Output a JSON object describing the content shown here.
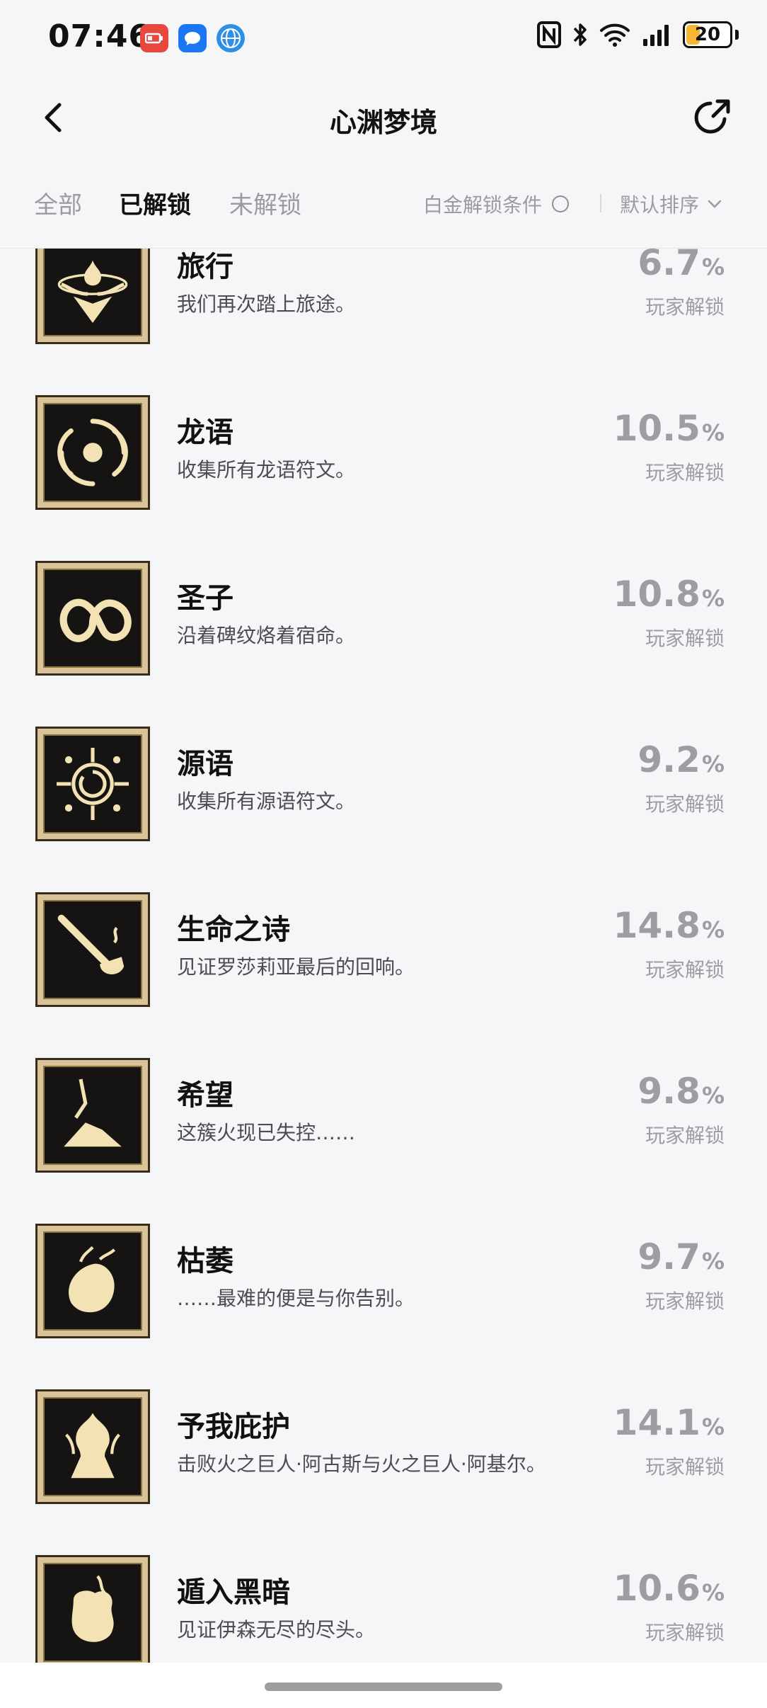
{
  "status_bar": {
    "time": "07:46",
    "battery": "20",
    "battery_level": 0.2,
    "notifications": [
      "battery-saver-icon",
      "message-icon",
      "browser-icon"
    ],
    "system_icons": [
      "nfc-icon",
      "bluetooth-icon",
      "wifi-icon",
      "signal-icon",
      "battery-icon"
    ]
  },
  "header": {
    "title": "心渊梦境"
  },
  "tabs": {
    "all": "全部",
    "unlocked": "已解锁",
    "locked": "未解锁",
    "active": "unlocked"
  },
  "filters": {
    "platinum_label": "白金解锁条件",
    "sort_label": "默认排序"
  },
  "achievements": [
    {
      "name": "旅行",
      "desc": "我们再次踏上旅途。",
      "percent": "6.7",
      "unit": "%",
      "caption": "玩家解锁",
      "icon": "winged-flame-icon"
    },
    {
      "name": "龙语",
      "desc": "收集所有龙语符文。",
      "percent": "10.5",
      "unit": "%",
      "caption": "玩家解锁",
      "icon": "vortex-icon"
    },
    {
      "name": "圣子",
      "desc": "沿着碑纹烙着宿命。",
      "percent": "10.8",
      "unit": "%",
      "caption": "玩家解锁",
      "icon": "knot-icon"
    },
    {
      "name": "源语",
      "desc": "收集所有源语符文。",
      "percent": "9.2",
      "unit": "%",
      "caption": "玩家解锁",
      "icon": "rune-circle-icon"
    },
    {
      "name": "生命之诗",
      "desc": "见证罗莎莉亚最后的回响。",
      "percent": "14.8",
      "unit": "%",
      "caption": "玩家解锁",
      "icon": "pipe-icon"
    },
    {
      "name": "希望",
      "desc": "这簇火现已失控……",
      "percent": "9.8",
      "unit": "%",
      "caption": "玩家解锁",
      "icon": "fallen-cloak-icon"
    },
    {
      "name": "枯萎",
      "desc": "……最难的便是与你告别。",
      "percent": "9.7",
      "unit": "%",
      "caption": "玩家解锁",
      "icon": "burning-hand-icon"
    },
    {
      "name": "予我庇护",
      "desc": "击败火之巨人·阿古斯与火之巨人·阿基尔。",
      "percent": "14.1",
      "unit": "%",
      "caption": "玩家解锁",
      "icon": "fire-giant-icon"
    },
    {
      "name": "遁入黑暗",
      "desc": "见证伊森无尽的尽头。",
      "percent": "10.6",
      "unit": "%",
      "caption": "玩家解锁",
      "icon": "clenched-fist-icon"
    }
  ],
  "colors": {
    "background": "#f5f6f8",
    "text_primary": "#111111",
    "text_muted": "#9c9ea3",
    "badge_gold": "#f3e2b4",
    "badge_frame": "#d9c49a",
    "battery_fill": "#f4b733"
  }
}
